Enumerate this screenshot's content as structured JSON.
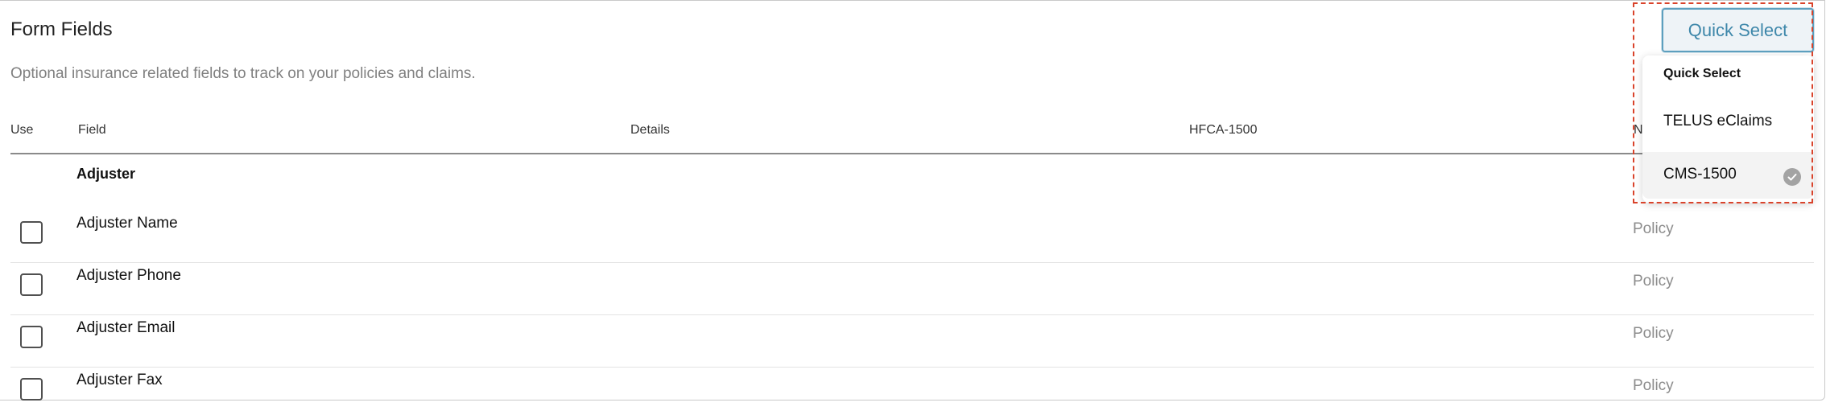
{
  "page": {
    "title": "Form Fields",
    "subtitle": "Optional insurance related fields to track on your policies and claims."
  },
  "table": {
    "headers": {
      "use": "Use",
      "field": "Field",
      "details": "Details",
      "hfca": "HFCA-1500",
      "partial_visible": "N"
    },
    "group": "Adjuster",
    "rows": [
      {
        "name": "Adjuster Name",
        "type": "Policy",
        "checked": false
      },
      {
        "name": "Adjuster Phone",
        "type": "Policy",
        "checked": false
      },
      {
        "name": "Adjuster Email",
        "type": "Policy",
        "checked": false
      },
      {
        "name": "Adjuster Fax",
        "type": "Policy",
        "checked": false
      }
    ]
  },
  "quick_select": {
    "button_label": "Quick Select",
    "menu_header": "Quick Select",
    "options": [
      {
        "label": "TELUS eClaims",
        "selected": false
      },
      {
        "label": "CMS-1500",
        "selected": true
      }
    ]
  },
  "colors": {
    "accent": "#3e87aa",
    "highlight_outline": "#d9432b",
    "muted_text": "#8c8c8c"
  },
  "icons": {
    "selected_option": "check-circle-icon",
    "row_checkbox": "checkbox-icon"
  }
}
